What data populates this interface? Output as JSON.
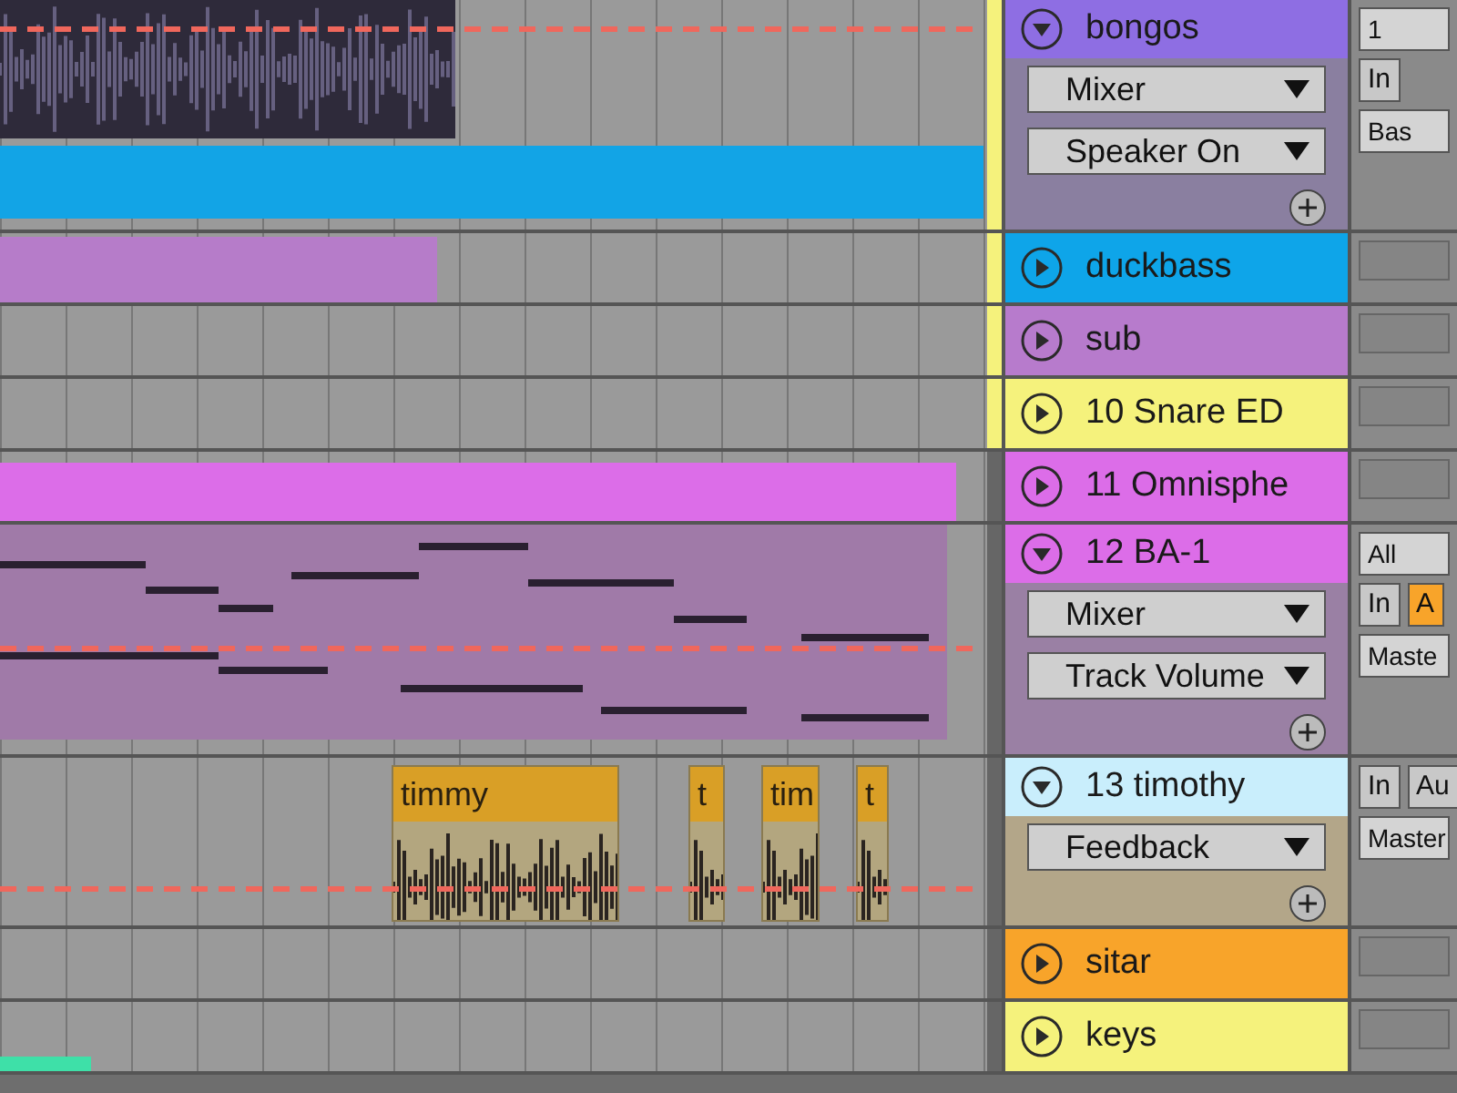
{
  "tracks": [
    {
      "name": "bongos",
      "color": "#8e6ee3",
      "expanded": true,
      "controls": [
        "Mixer",
        "Speaker On"
      ],
      "mixer": [
        {
          "kind": "field",
          "label": "1"
        },
        {
          "kind": "toggle",
          "label": "In",
          "on": false
        },
        {
          "kind": "field",
          "label": "Bas"
        }
      ]
    },
    {
      "name": "duckbass",
      "color": "#0ea5e9",
      "expanded": false
    },
    {
      "name": "sub",
      "color": "#b77bcc",
      "expanded": false
    },
    {
      "name": "10 Snare ED",
      "color": "#f5f27c",
      "expanded": false
    },
    {
      "name": "11 Omnisphe",
      "color": "#dc6de8",
      "expanded": false
    },
    {
      "name": "12 BA-1",
      "color": "#dc6de8",
      "expanded": true,
      "controls": [
        "Mixer",
        "Track Volume"
      ],
      "mixer": [
        {
          "kind": "field",
          "label": "All"
        },
        {
          "kind": "toggle",
          "label": "In",
          "on": false
        },
        {
          "kind": "toggle",
          "label": "A",
          "on": true
        },
        {
          "kind": "field",
          "label": "Maste"
        }
      ]
    },
    {
      "name": "13 timothy",
      "color": "#c9eefc",
      "expanded": true,
      "controls": [
        "Feedback"
      ],
      "clips": [
        {
          "label": "timmy"
        },
        {
          "label": "t"
        },
        {
          "label": "tim"
        },
        {
          "label": "t"
        }
      ],
      "mixer": [
        {
          "kind": "toggle",
          "label": "In",
          "on": false
        },
        {
          "kind": "toggle",
          "label": "Au",
          "on": false
        },
        {
          "kind": "field",
          "label": "Master"
        }
      ]
    },
    {
      "name": "sitar",
      "color": "#f8a42a",
      "expanded": false
    },
    {
      "name": "keys",
      "color": "#f5f27c",
      "expanded": false
    }
  ]
}
